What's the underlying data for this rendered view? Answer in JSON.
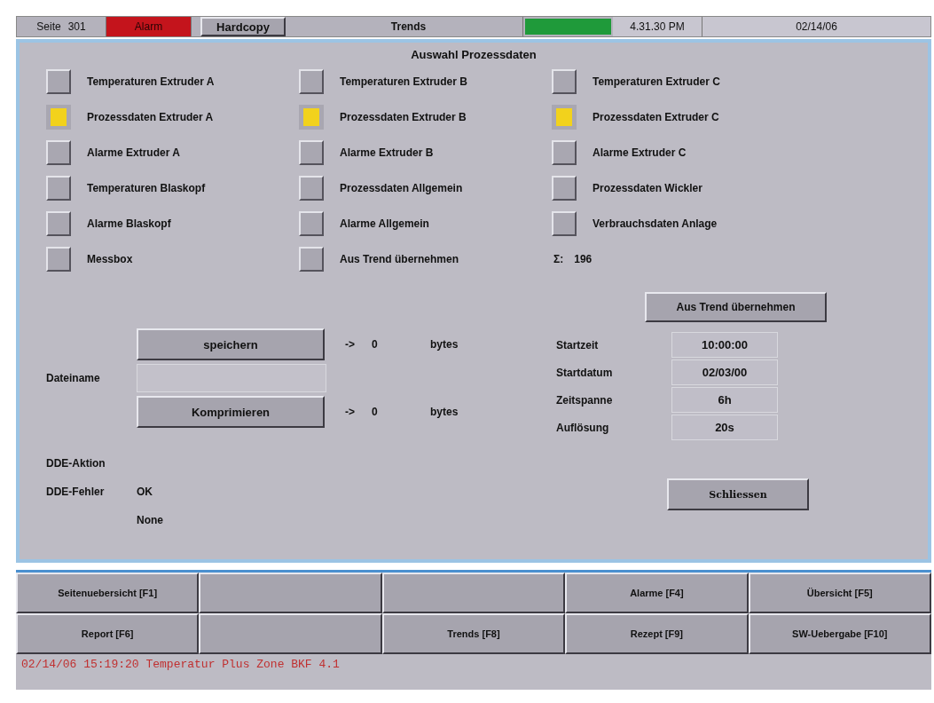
{
  "header": {
    "page_label": "Seite",
    "page_number": "301",
    "alarm": "Alarm",
    "hardcopy": "Hardcopy",
    "title": "Trends",
    "time": "4.31.30 PM",
    "date": "02/14/06"
  },
  "panel": {
    "title": "Auswahl Prozessdaten",
    "options": [
      {
        "label": "Temperaturen Extruder A",
        "checked": false
      },
      {
        "label": "Temperaturen Extruder B",
        "checked": false
      },
      {
        "label": "Temperaturen Extruder C",
        "checked": false
      },
      {
        "label": "Prozessdaten Extruder A",
        "checked": true
      },
      {
        "label": "Prozessdaten Extruder B",
        "checked": true
      },
      {
        "label": "Prozessdaten Extruder C",
        "checked": true
      },
      {
        "label": "Alarme Extruder A",
        "checked": false
      },
      {
        "label": "Alarme Extruder B",
        "checked": false
      },
      {
        "label": "Alarme Extruder C",
        "checked": false
      },
      {
        "label": "Temperaturen Blaskopf",
        "checked": false
      },
      {
        "label": "Prozessdaten Allgemein",
        "checked": false
      },
      {
        "label": "Prozessdaten Wickler",
        "checked": false
      },
      {
        "label": "Alarme Blaskopf",
        "checked": false
      },
      {
        "label": "Alarme Allgemein",
        "checked": false
      },
      {
        "label": "Verbrauchsdaten Anlage",
        "checked": false
      },
      {
        "label": "Messbox",
        "checked": false
      },
      {
        "label": "Aus Trend übernehmen",
        "checked": false
      }
    ],
    "sum_symbol": "Σ:",
    "sum_value": "196",
    "save_button": "speichern",
    "save_arrow": "->",
    "save_count": "0",
    "save_unit": "bytes",
    "filename_label": "Dateiname",
    "compress_button": "Komprimieren",
    "compress_arrow": "->",
    "compress_count": "0",
    "compress_unit": "bytes",
    "from_trend_button": "Aus Trend übernehmen",
    "fields": [
      {
        "label": "Startzeit",
        "value": "10:00:00"
      },
      {
        "label": "Startdatum",
        "value": "02/03/00"
      },
      {
        "label": "Zeitspanne",
        "value": "6h"
      },
      {
        "label": "Auflösung",
        "value": "20s"
      }
    ],
    "dde_action_label": "DDE-Aktion",
    "dde_error_label": "DDE-Fehler",
    "dde_error_value": "OK",
    "dde_error_detail": "None",
    "close_button": "Schliessen"
  },
  "function_keys": [
    {
      "kind": "key",
      "label": "Seitenuebersicht [F1]"
    },
    {
      "kind": "blank"
    },
    {
      "kind": "blank"
    },
    {
      "kind": "key",
      "label": "Alarme [F4]"
    },
    {
      "kind": "key",
      "label": "Übersicht [F5]"
    },
    {
      "kind": "key",
      "label": "Report [F6]"
    },
    {
      "kind": "blank"
    },
    {
      "kind": "key",
      "label": "Trends [F8]"
    },
    {
      "kind": "key",
      "label": "Rezept [F9]"
    },
    {
      "kind": "key",
      "label": "SW-Uebergabe [F10]"
    }
  ],
  "status_message": "02/14/06 15:19:20 Temperatur Plus Zone BKF 4.1"
}
